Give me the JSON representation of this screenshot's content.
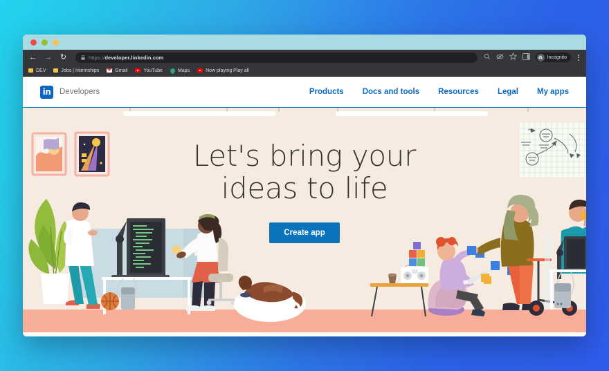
{
  "desktop": {
    "gradient_from": "#22D3EE",
    "gradient_to": "#2F5BEA"
  },
  "browser": {
    "titlebar": {
      "dots": [
        {
          "name": "close",
          "color": "#F24B4B"
        },
        {
          "name": "minimize",
          "color": "#97BE2F"
        },
        {
          "name": "maximize",
          "color": "#FBBF5A"
        }
      ]
    },
    "toolbar": {
      "back": "←",
      "forward": "→",
      "reload": "↻",
      "url_scheme": "https://",
      "url_host": "developer.linkedin.com",
      "icons": [
        "search-icon",
        "eye-slash-icon",
        "star-icon",
        "side-panel-icon"
      ],
      "profile_label": "Incognito"
    },
    "bookmarks": [
      {
        "label": "DEV",
        "icon": "folder-icon"
      },
      {
        "label": "Jobs | Internships",
        "icon": "folder-icon"
      },
      {
        "label": "Gmail",
        "icon": "gmail-icon"
      },
      {
        "label": "YouTube",
        "icon": "youtube-icon"
      },
      {
        "label": "Maps",
        "icon": "maps-pin-icon"
      },
      {
        "label": "Now playing Play all",
        "icon": "youtube-icon"
      }
    ]
  },
  "site": {
    "brand": {
      "logo_text": "in",
      "logo_color": "#0A66C2",
      "name": "Developers"
    },
    "nav_links": [
      {
        "label": "Products"
      },
      {
        "label": "Docs and tools"
      },
      {
        "label": "Resources"
      },
      {
        "label": "Legal"
      },
      {
        "label": "My apps"
      }
    ],
    "hero": {
      "headline_line1": "Let's bring your",
      "headline_line2": "ideas to life",
      "cta_label": "Create app",
      "cta_color": "#0B72BC",
      "background_color": "#F6EBE0",
      "floor_color": "#F8AD98"
    }
  }
}
